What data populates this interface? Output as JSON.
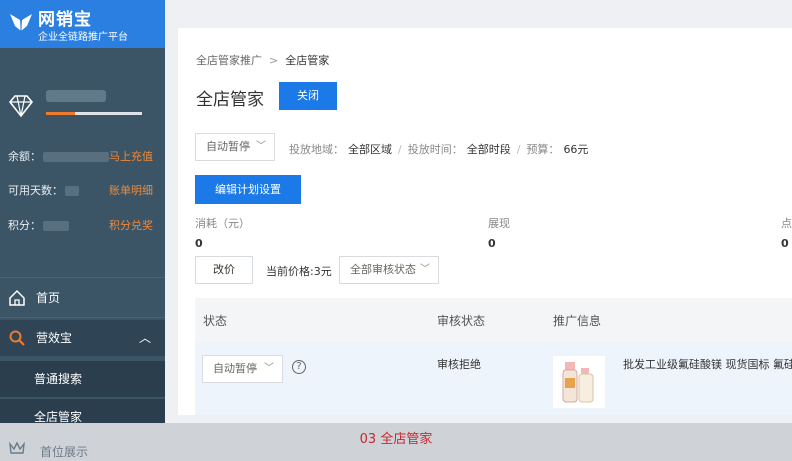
{
  "app": {
    "brand_title": "网销宝",
    "brand_subtitle": "企业全链路推广平台",
    "accent_color": "#1b7ae8"
  },
  "account": {
    "level_progress": 0.3,
    "balance_label": "余额：",
    "balance_link": "马上充值",
    "days_label": "可用天数：",
    "days_link": "账单明细",
    "points_label": "积分：",
    "points_link": "积分兑奖"
  },
  "sidebar": {
    "items": [
      {
        "label": "首页",
        "icon": "home-icon"
      },
      {
        "label": "营效宝",
        "icon": "search-icon",
        "expanded": true
      },
      {
        "label": "普通搜索"
      },
      {
        "label": "全店管家",
        "active": true
      },
      {
        "label": "首位展示",
        "icon": "crown-icon"
      }
    ]
  },
  "breadcrumb": {
    "parent": "全店管家推广",
    "separator": ">",
    "current": "全店管家"
  },
  "page": {
    "title": "全店管家",
    "close_label": "关闭"
  },
  "plan": {
    "status_select": "自动暂停",
    "region_label": "投放地域：",
    "region_value": "全部区域",
    "time_label": "投放时间：",
    "time_value": "全部时段",
    "budget_label": "预算：",
    "budget_value": "66元",
    "edit_label": "编辑计划设置"
  },
  "metrics": [
    {
      "label": "消耗（元）",
      "value": "0"
    },
    {
      "label": "展现",
      "value": "0"
    },
    {
      "label": "点",
      "value": "0"
    }
  ],
  "price": {
    "change_label": "改价",
    "current_label": "当前价格:3元",
    "review_filter": "全部审核状态"
  },
  "table": {
    "columns": [
      "状态",
      "审核状态",
      "推广信息"
    ],
    "rows": [
      {
        "status": "自动暂停",
        "review": "审核拒绝",
        "info": "批发工业级氟硅酸镁 现货国标 氟硅酸"
      }
    ]
  },
  "caption": "03 全店管家"
}
